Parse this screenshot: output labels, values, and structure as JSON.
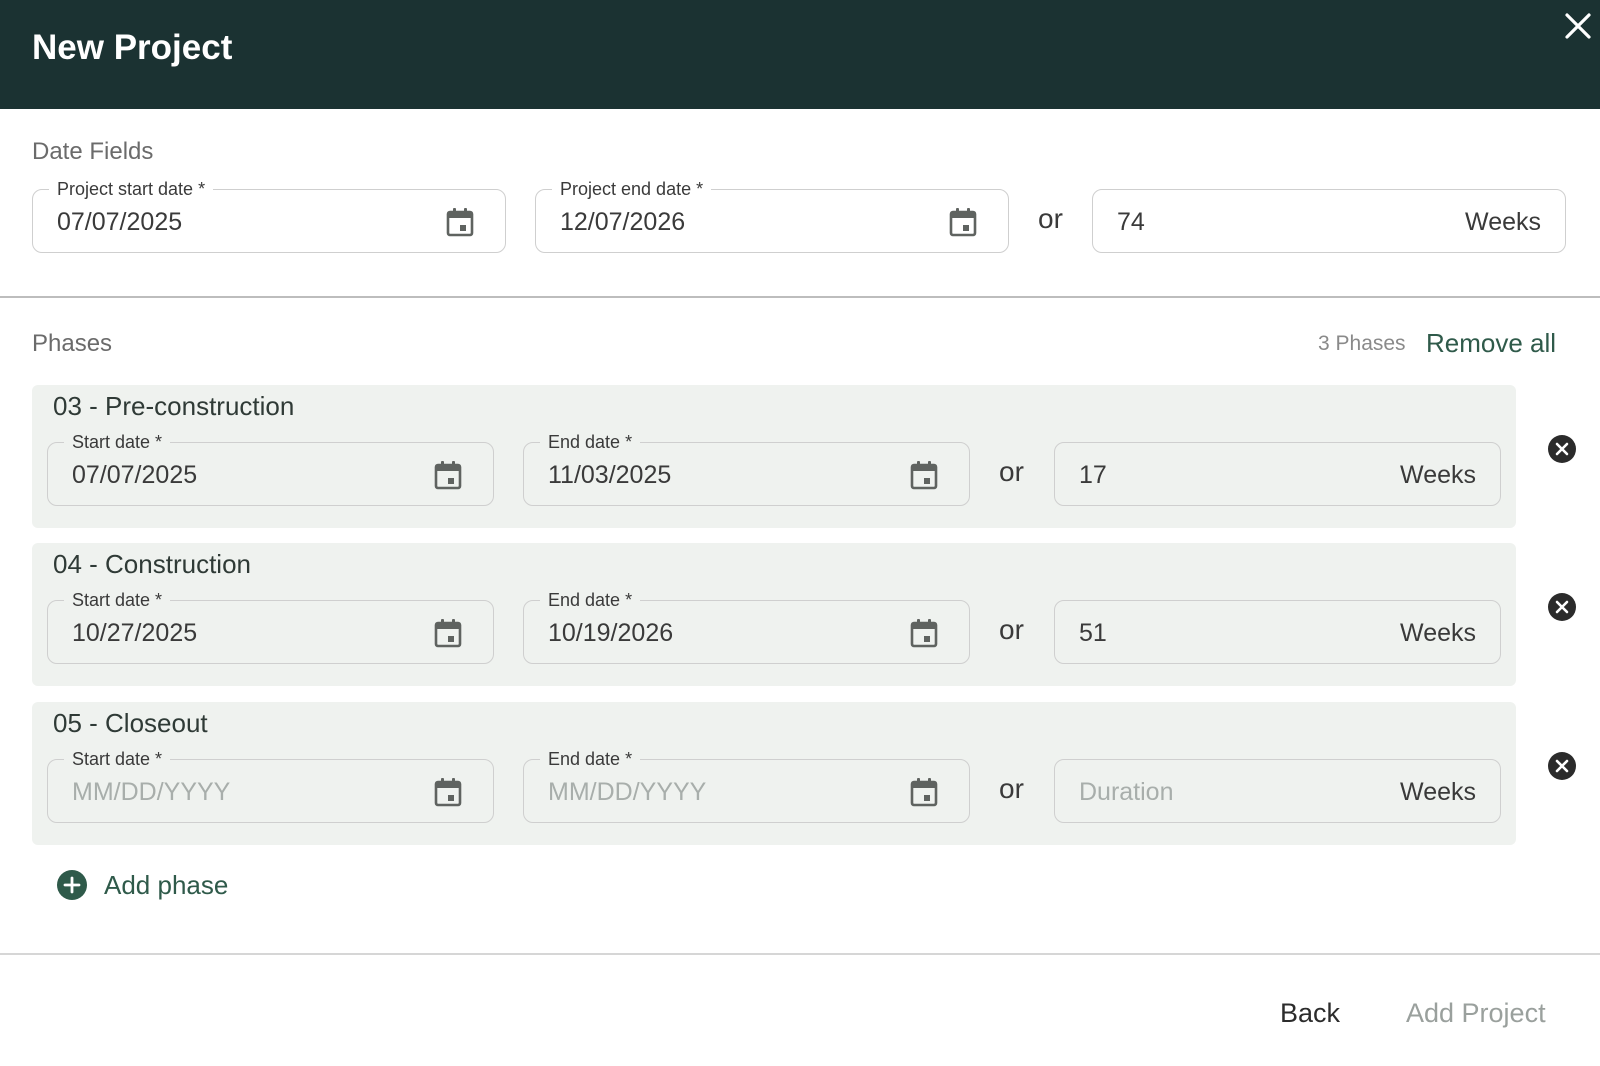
{
  "header": {
    "title": "New Project"
  },
  "date_fields": {
    "section_title": "Date Fields",
    "start": {
      "label": "Project start date *",
      "value": "07/07/2025"
    },
    "end": {
      "label": "Project end date *",
      "value": "12/07/2026"
    },
    "or_label": "or",
    "duration": {
      "value": "74",
      "unit": "Weeks"
    }
  },
  "phases": {
    "section_title": "Phases",
    "count_label": "3 Phases",
    "remove_all_label": "Remove all",
    "items": [
      {
        "title": "03 - Pre-construction",
        "start_label": "Start date *",
        "start_value": "07/07/2025",
        "end_label": "End date *",
        "end_value": "11/03/2025",
        "or_label": "or",
        "duration_value": "17",
        "duration_unit": "Weeks"
      },
      {
        "title": "04 - Construction",
        "start_label": "Start date *",
        "start_value": "10/27/2025",
        "end_label": "End date *",
        "end_value": "10/19/2026",
        "or_label": "or",
        "duration_value": "51",
        "duration_unit": "Weeks"
      },
      {
        "title": "05 - Closeout",
        "start_label": "Start date *",
        "start_placeholder": "MM/DD/YYYY",
        "end_label": "End date *",
        "end_placeholder": "MM/DD/YYYY",
        "or_label": "or",
        "duration_placeholder": "Duration",
        "duration_unit": "Weeks"
      }
    ],
    "add_phase_label": "Add phase"
  },
  "footer": {
    "back_label": "Back",
    "add_project_label": "Add Project"
  },
  "colors": {
    "header_bg": "#1b3232",
    "card_bg": "#eff2ef",
    "accent": "#2f5a4a",
    "disabled_text": "#9aa09d",
    "placeholder_text": "#a8aeab"
  },
  "icons": {
    "close": "close-icon",
    "calendar": "calendar-icon",
    "remove_phase": "remove-circle-icon",
    "add_phase": "add-circle-icon"
  }
}
